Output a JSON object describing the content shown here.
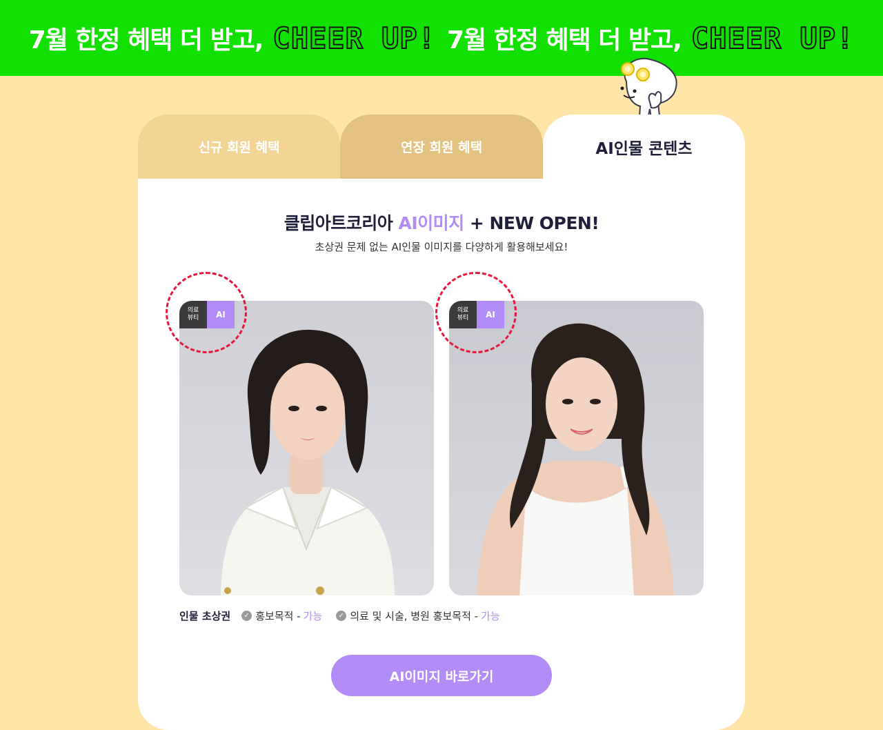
{
  "banner": {
    "segments": [
      {
        "korean": "7월 한정 혜택 더 받고,",
        "english": "CHEER UP!"
      },
      {
        "korean": "7월 한정 혜택 더 받고,",
        "english": "CHEER UP!"
      }
    ],
    "background_color": "#12e000"
  },
  "tabs": [
    {
      "label": "신규 회원 혜택",
      "active": false
    },
    {
      "label": "연장 회원 혜택",
      "active": false
    },
    {
      "label": "AI인물 콘텐츠",
      "active": true
    }
  ],
  "content": {
    "headline_before": "클립아트코리아 ",
    "headline_highlight": "AI이미지",
    "headline_after": " + NEW OPEN!",
    "subtitle": "초상권 문제 없는 AI인물 이미지를 다양하게 활용해보세요!",
    "accent_color": "#b28bf6"
  },
  "images": [
    {
      "category_line1": "의료",
      "category_line2": "뷰티",
      "ai_label": "AI",
      "icon": "portrait-woman-white-blazer"
    },
    {
      "category_line1": "의료",
      "category_line2": "뷰티",
      "ai_label": "AI",
      "icon": "portrait-woman-white-top"
    }
  ],
  "rights": {
    "title": "인물 초상권",
    "items": [
      {
        "label": "홍보목적 -",
        "status": "가능"
      },
      {
        "label": "의료 및 시술, 병원 홍보목적 -",
        "status": "가능"
      }
    ]
  },
  "cta": {
    "label": "AI이미지 바로가기"
  }
}
